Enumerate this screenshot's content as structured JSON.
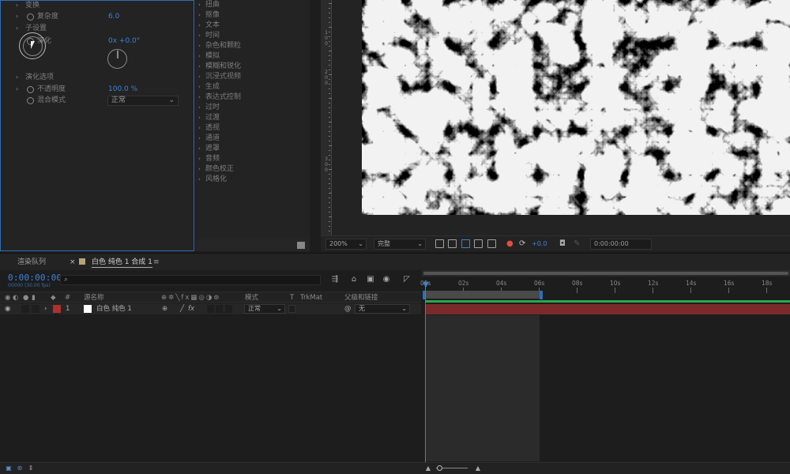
{
  "effect_controls": {
    "rows": [
      {
        "label": "变换",
        "arrow": "›"
      },
      {
        "label": "复杂度",
        "value": "6.0"
      },
      {
        "label": "子设置",
        "arrow": "›"
      },
      {
        "label": "演化",
        "value": "0x +0.0°"
      },
      {
        "label": "演化选项",
        "arrow": "›"
      },
      {
        "label": "不透明度",
        "value": "100.0 %"
      },
      {
        "label": "混合模式"
      }
    ],
    "blend_mode_value": "正常"
  },
  "effects_list": [
    "扭曲",
    "抠像",
    "文本",
    "时间",
    "杂色和颗粒",
    "模拟",
    "模糊和锐化",
    "沉浸式视频",
    "生成",
    "表达式控制",
    "过时",
    "过渡",
    "透视",
    "通道",
    "遮罩",
    "音频",
    "颜色校正",
    "风格化"
  ],
  "ruler_numbers": [
    "1",
    "0",
    "0",
    "2",
    "0",
    "0",
    "3",
    "0",
    "0"
  ],
  "viewer_toolbar": {
    "zoom": "200%",
    "resolution": "完整",
    "exposure": "+0.0",
    "timecode": "0:00:00:00"
  },
  "timeline": {
    "tab_render_queue": "渲染队列",
    "tab_comp": "白色 纯色 1 合成 1",
    "tab_close": "×",
    "tab_menu": "≡",
    "current_time": "0:00:00:00",
    "current_time_sub": "00000 (30.00 fps)",
    "columns": {
      "source_name": "源名称",
      "hash": "#",
      "mode": "模式",
      "t": "T",
      "trkmat": "TrkMat",
      "parent": "父级和链接"
    },
    "layer": {
      "number": "1",
      "name": "白色 纯色 1",
      "mode": "正常",
      "parent": "无",
      "label_color": "#b03030"
    },
    "ruler_labels": [
      "00s",
      "02s",
      "04s",
      "06s",
      "08s",
      "10s",
      "12s",
      "14s",
      "16s",
      "18s"
    ]
  },
  "colors": {
    "accent": "#3b82d6",
    "layer_bar": "#7a2a2a",
    "green_line": "#2ca84a"
  }
}
